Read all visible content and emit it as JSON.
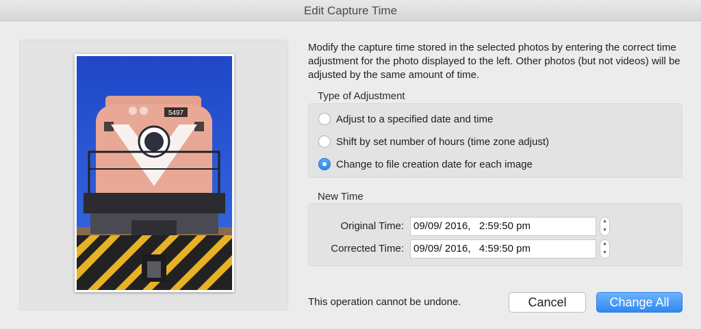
{
  "window": {
    "title": "Edit Capture Time"
  },
  "description": "Modify the capture time stored in the selected photos by entering the correct time adjustment for the photo displayed to the left. Other photos (but not videos) will be adjusted by the same amount of time.",
  "adjustment": {
    "label": "Type of Adjustment",
    "options": [
      {
        "label": "Adjust to a specified date and time",
        "checked": false
      },
      {
        "label": "Shift by set number of hours (time zone adjust)",
        "checked": false
      },
      {
        "label": "Change to file creation date for each image",
        "checked": true
      }
    ]
  },
  "new_time": {
    "label": "New Time",
    "original_label": "Original Time:",
    "original_value": "09/09/ 2016,   2:59:50 pm",
    "corrected_label": "Corrected Time:",
    "corrected_value": "09/09/ 2016,   4:59:50 pm"
  },
  "photo": {
    "locomotive_number": "5497"
  },
  "footer": {
    "warning": "This operation cannot be undone.",
    "cancel_label": "Cancel",
    "change_all_label": "Change All"
  },
  "colors": {
    "accent": "#2f88f0",
    "background": "#ececec"
  }
}
